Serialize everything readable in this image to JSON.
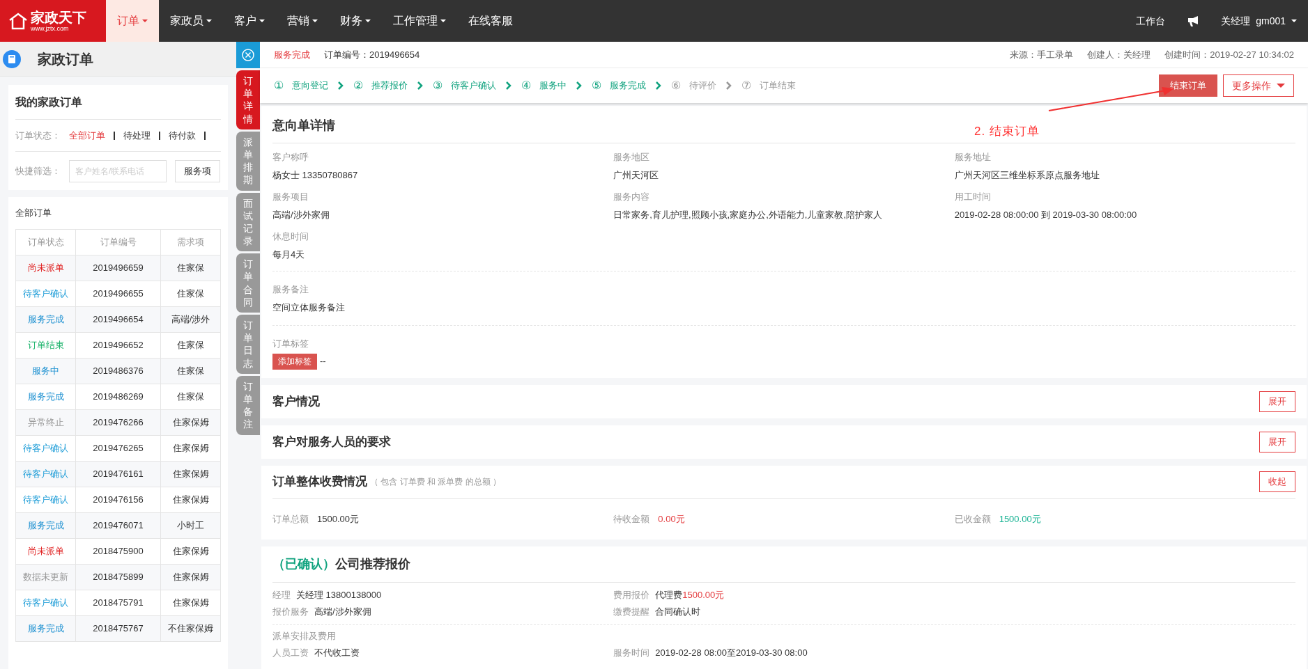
{
  "nav": {
    "logo": {
      "name": "家政天下",
      "url": "www.jztx.com"
    },
    "items": [
      {
        "label": "订单",
        "selected": true,
        "dropdown": true
      },
      {
        "label": "家政员",
        "selected": false,
        "dropdown": true
      },
      {
        "label": "客户",
        "selected": false,
        "dropdown": true
      },
      {
        "label": "营销",
        "selected": false,
        "dropdown": true
      },
      {
        "label": "财务",
        "selected": false,
        "dropdown": true
      },
      {
        "label": "工作管理",
        "selected": false,
        "dropdown": true
      },
      {
        "label": "在线客服",
        "selected": false,
        "dropdown": false
      }
    ],
    "workbench": "工作台",
    "user": "关经理",
    "account": "gm001"
  },
  "sidebar": {
    "title": "家政订单",
    "card_title": "我的家政订单",
    "status_label": "订单状态：",
    "status_filters": [
      {
        "label": "全部订单",
        "selected": true
      },
      {
        "label": "待处理",
        "selected": false
      },
      {
        "label": "待付款",
        "selected": false
      }
    ],
    "quick_filter_label": "快捷筛选：",
    "search": {
      "placeholder": "客户姓名/联系电话"
    },
    "service_select": "服务项",
    "list_title": "全部订单",
    "table": {
      "columns": [
        "订单状态",
        "订单编号",
        "需求项"
      ],
      "rows": [
        {
          "status": "尚未派单",
          "color": "#e02020",
          "number": "2019496659",
          "item": "住家保"
        },
        {
          "status": "待客户确认",
          "color": "#1a9bd7",
          "number": "2019496655",
          "item": "住家保"
        },
        {
          "status": "服务完成",
          "color": "#1a8fd0",
          "number": "2019496654",
          "item": "高端/涉外"
        },
        {
          "status": "订单结束",
          "color": "#1ab36a",
          "number": "2019496652",
          "item": "住家保"
        },
        {
          "status": "服务中",
          "color": "#1a8fd0",
          "number": "2019486376",
          "item": "住家保"
        },
        {
          "status": "服务完成",
          "color": "#1a8fd0",
          "number": "2019486269",
          "item": "住家保"
        },
        {
          "status": "异常终止",
          "color": "#999999",
          "number": "2019476266",
          "item": "住家保姆"
        },
        {
          "status": "待客户确认",
          "color": "#1a9bd7",
          "number": "2019476265",
          "item": "住家保姆"
        },
        {
          "status": "待客户确认",
          "color": "#1a9bd7",
          "number": "2019476161",
          "item": "住家保姆"
        },
        {
          "status": "待客户确认",
          "color": "#1a9bd7",
          "number": "2019476156",
          "item": "住家保姆"
        },
        {
          "status": "服务完成",
          "color": "#1a8fd0",
          "number": "2019476071",
          "item": "小时工"
        },
        {
          "status": "尚未派单",
          "color": "#e02020",
          "number": "2018475900",
          "item": "住家保姆"
        },
        {
          "status": "数据未更新",
          "color": "#999999",
          "number": "2018475899",
          "item": "住家保姆"
        },
        {
          "status": "待客户确认",
          "color": "#1a9bd7",
          "number": "2018475791",
          "item": "住家保姆"
        },
        {
          "status": "服务完成",
          "color": "#1a8fd0",
          "number": "2018475767",
          "item": "不住家保姆"
        }
      ]
    }
  },
  "side_tabs": [
    {
      "label": "订单详情",
      "selected": true
    },
    {
      "label": "派单排期",
      "selected": false
    },
    {
      "label": "面试记录",
      "selected": false
    },
    {
      "label": "订单合同",
      "selected": false
    },
    {
      "label": "订单日志",
      "selected": false
    },
    {
      "label": "订单备注",
      "selected": false
    }
  ],
  "order": {
    "status": "服务完成",
    "number": "订单编号：2019496654",
    "meta": [
      "来源：手工录单",
      "创建人：关经理",
      "创建时间：2019-02-27 10:34:02"
    ],
    "steps": [
      {
        "number": "①",
        "label": "意向登记",
        "done": true
      },
      {
        "number": "②",
        "label": "推荐报价",
        "done": true
      },
      {
        "number": "③",
        "label": "待客户确认",
        "done": true
      },
      {
        "number": "④",
        "label": "服务中",
        "done": true
      },
      {
        "number": "⑤",
        "label": "服务完成",
        "done": true
      },
      {
        "number": "⑥",
        "label": "待评价",
        "done": false
      },
      {
        "number": "⑦",
        "label": "订单结束",
        "done": false
      }
    ],
    "primary_action": "结束订单",
    "more_action": "更多操作",
    "annotation": "2. 结束订单",
    "intent": {
      "title": "意向单详情",
      "fields": [
        {
          "label": "客户称呼",
          "value": "杨女士 13350780867"
        },
        {
          "label": "服务地区",
          "value": "广州天河区"
        },
        {
          "label": "服务地址",
          "value": "广州天河区三维坐标系原点服务地址"
        },
        {
          "label": "服务项目",
          "value": "高端/涉外家佣"
        },
        {
          "label": "服务内容",
          "value": "日常家务,育儿护理,照顾小孩,家庭办公,外语能力,儿童家教,陪护家人"
        },
        {
          "label": "用工时间",
          "value": "2019-02-28 08:00:00 到 2019-03-30 08:00:00"
        },
        {
          "label": "休息时间",
          "value": "每月4天"
        }
      ],
      "remark": {
        "label": "服务备注",
        "value": "空间立体服务备注"
      },
      "tags": {
        "label": "订单标签",
        "button": "添加标签",
        "value": "--"
      }
    },
    "sections": [
      {
        "title": "客户情况",
        "toggle": "展开",
        "expanded": false
      },
      {
        "title": "客户对服务人员的要求",
        "toggle": "展开",
        "expanded": false
      },
      {
        "title": "订单整体收费情况",
        "note": "（ 包含 订单费 和 派单费 的总额 ）",
        "toggle": "收起",
        "expanded": true,
        "amounts": [
          {
            "label": "订单总额",
            "value": "1500.00元",
            "color": "#333333"
          },
          {
            "label": "待收金额",
            "value": "0.00元",
            "color": "#e4393c"
          },
          {
            "label": "已收金额",
            "value": "1500.00元",
            "color": "#1ab394"
          }
        ]
      }
    ],
    "quote": {
      "status": "（已确认）",
      "title": "公司推荐报价",
      "rows": [
        [
          {
            "label": "经理",
            "value": "关经理 13800138000"
          },
          {
            "label": "费用报价",
            "value": "代理费",
            "amount": "1500.00元"
          }
        ],
        [
          {
            "label": "报价服务",
            "value": "高端/涉外家佣"
          },
          {
            "label": "缴费提醒",
            "value": "合同确认时"
          }
        ]
      ],
      "dispatch_title": "派单安排及费用",
      "dispatch_rows": [
        [
          {
            "label": "人员工资",
            "value": "不代收工资"
          },
          {
            "label": "服务时间",
            "value": "2019-02-28 08:00至2019-03-30 08:00"
          }
        ]
      ]
    }
  }
}
